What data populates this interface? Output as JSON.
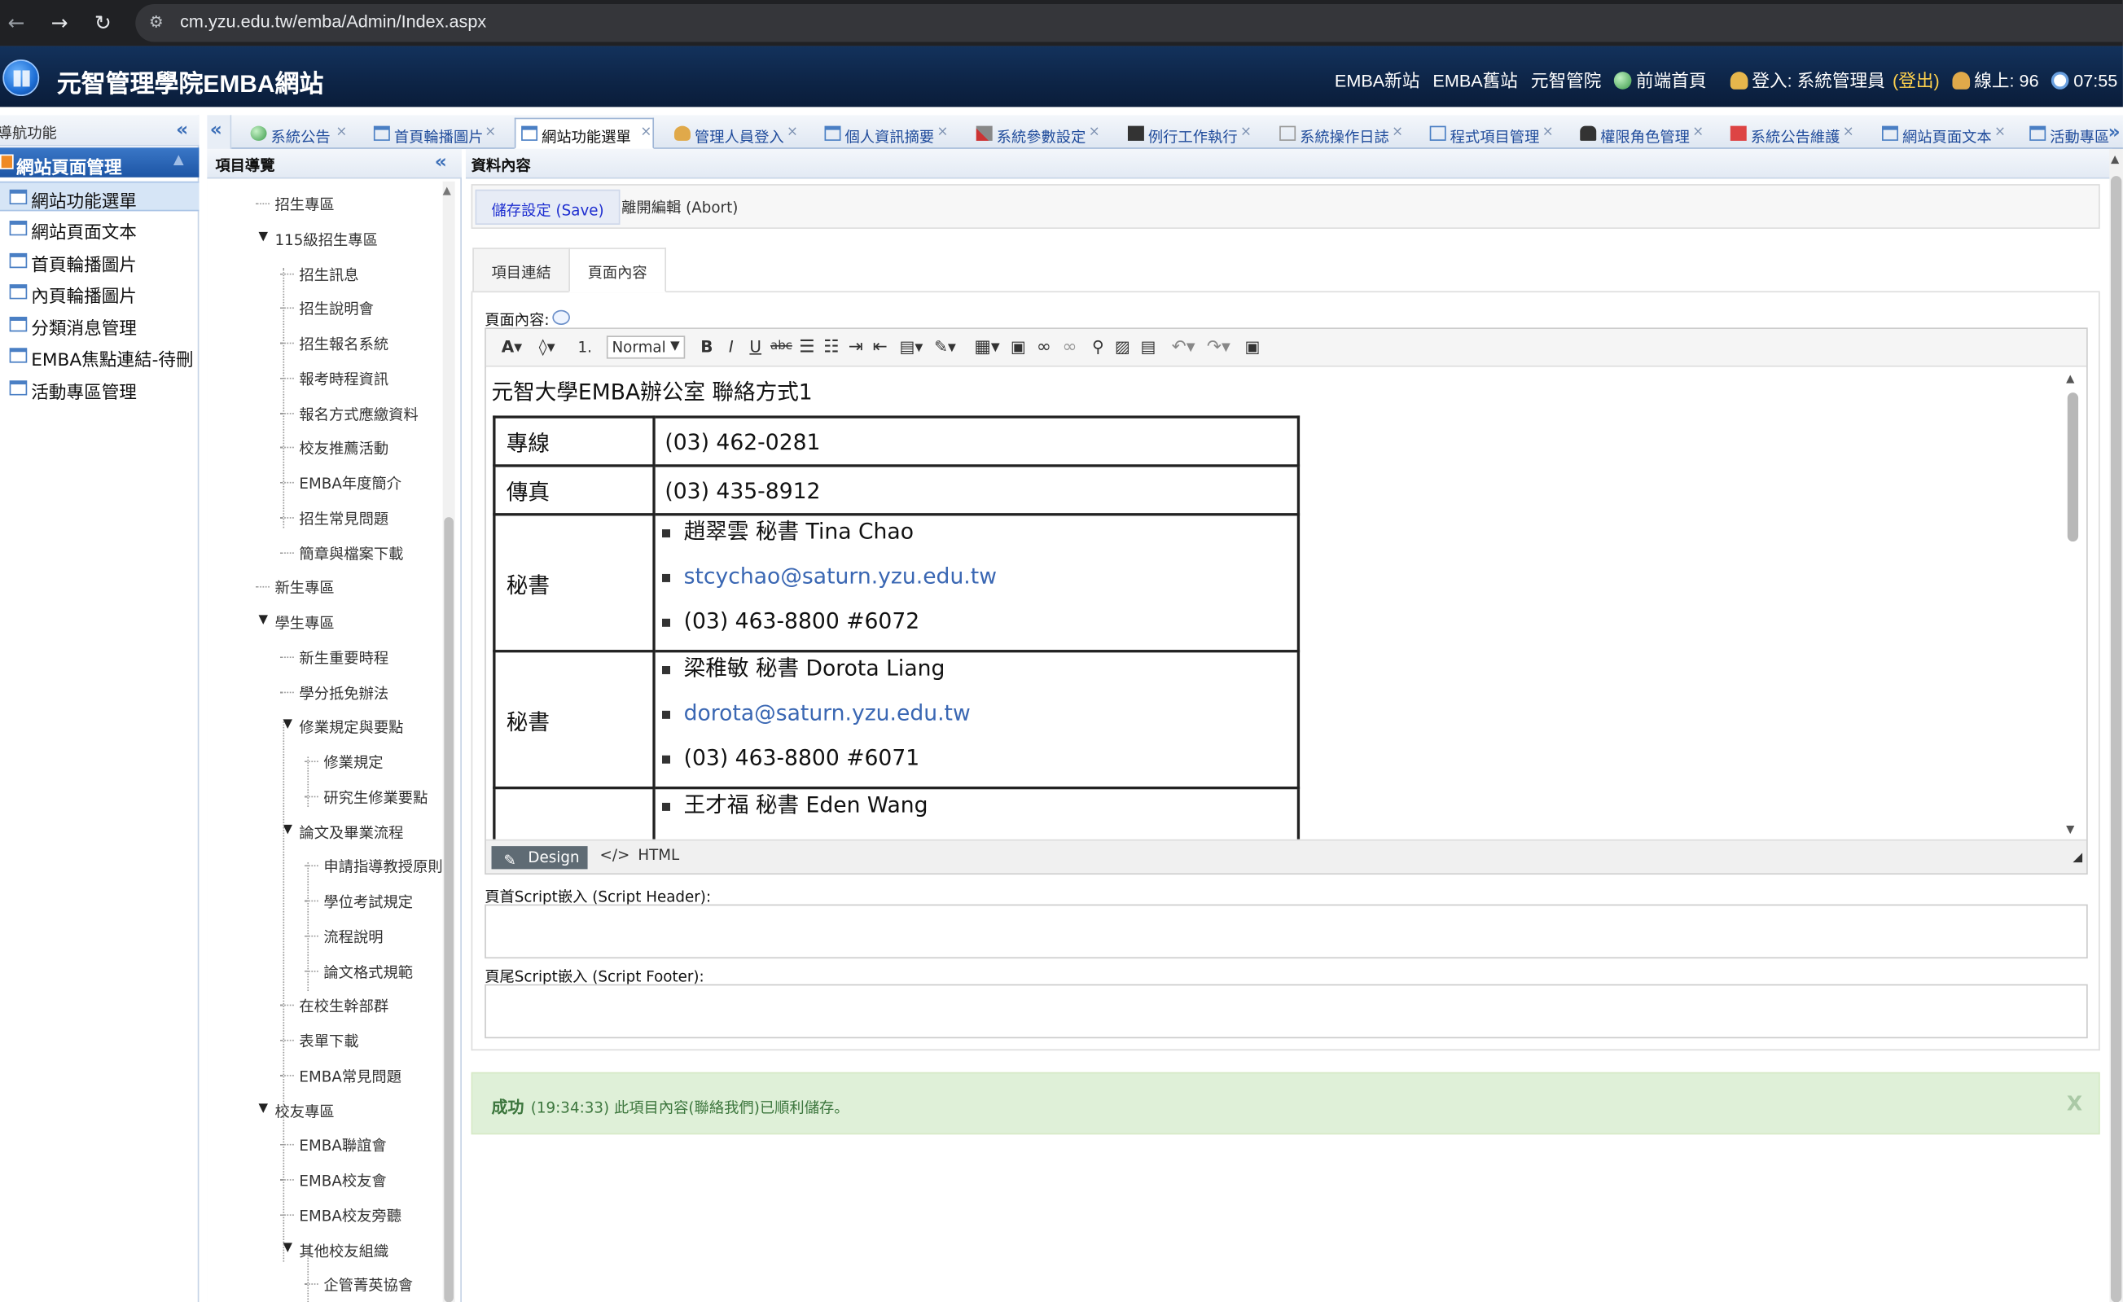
{
  "browser": {
    "url": "cm.yzu.edu.tw/emba/Admin/Index.aspx"
  },
  "header": {
    "title": "元智管理學院EMBA網站",
    "links": [
      "EMBA新站",
      "EMBA舊站",
      "元智管院"
    ],
    "frontend": "前端首頁",
    "login_label": "登入: 系統管理員",
    "logout": "(登出)",
    "online": "線上: 96",
    "time": "07:55"
  },
  "left_sidebar": {
    "title": "導航功能",
    "section": "網站頁面管理",
    "items": [
      {
        "label": "網站功能選單",
        "selected": true
      },
      {
        "label": "網站頁面文本"
      },
      {
        "label": "首頁輪播圖片"
      },
      {
        "label": "內頁輪播圖片"
      },
      {
        "label": "分類消息管理"
      },
      {
        "label": "EMBA焦點連結-待刪"
      },
      {
        "label": "活動專區管理"
      }
    ]
  },
  "tabs": [
    {
      "label": "系統公告"
    },
    {
      "label": "首頁輪播圖片"
    },
    {
      "label": "網站功能選單",
      "active": true
    },
    {
      "label": "管理人員登入"
    },
    {
      "label": "個人資訊摘要"
    },
    {
      "label": "系統參數設定"
    },
    {
      "label": "例行工作執行"
    },
    {
      "label": "系統操作日誌"
    },
    {
      "label": "程式項目管理"
    },
    {
      "label": "權限角色管理"
    },
    {
      "label": "系統公告維護"
    },
    {
      "label": "網站頁面文本"
    },
    {
      "label": "活動專區"
    }
  ],
  "tree": {
    "title": "項目導覽",
    "nodes": [
      {
        "label": "招生專區",
        "level": 1
      },
      {
        "label": "115級招生專區",
        "level": 1,
        "expanded": true
      },
      {
        "label": "招生訊息",
        "level": 2
      },
      {
        "label": "招生說明會",
        "level": 2
      },
      {
        "label": "招生報名系統",
        "level": 2
      },
      {
        "label": "報考時程資訊",
        "level": 2
      },
      {
        "label": "報名方式應繳資料",
        "level": 2
      },
      {
        "label": "校友推薦活動",
        "level": 2
      },
      {
        "label": "EMBA年度簡介",
        "level": 2
      },
      {
        "label": "招生常見問題",
        "level": 2
      },
      {
        "label": "簡章與檔案下載",
        "level": 2
      },
      {
        "label": "新生專區",
        "level": 1
      },
      {
        "label": "學生專區",
        "level": 1,
        "expanded": true
      },
      {
        "label": "新生重要時程",
        "level": 2
      },
      {
        "label": "學分抵免辦法",
        "level": 2
      },
      {
        "label": "修業規定與要點",
        "level": 2,
        "expanded": true
      },
      {
        "label": "修業規定",
        "level": 3
      },
      {
        "label": "研究生修業要點",
        "level": 3
      },
      {
        "label": "論文及畢業流程",
        "level": 2,
        "expanded": true
      },
      {
        "label": "申請指導教授原則",
        "level": 3
      },
      {
        "label": "學位考試規定",
        "level": 3
      },
      {
        "label": "流程說明",
        "level": 3
      },
      {
        "label": "論文格式規範",
        "level": 3
      },
      {
        "label": "在校生幹部群",
        "level": 2
      },
      {
        "label": "表單下載",
        "level": 2
      },
      {
        "label": "EMBA常見問題",
        "level": 2
      },
      {
        "label": "校友專區",
        "level": 1,
        "expanded": true
      },
      {
        "label": "EMBA聯誼會",
        "level": 2
      },
      {
        "label": "EMBA校友會",
        "level": 2
      },
      {
        "label": "EMBA校友旁聽",
        "level": 2
      },
      {
        "label": "其他校友組織",
        "level": 2,
        "expanded": true
      },
      {
        "label": "企管菁英協會",
        "level": 3
      }
    ]
  },
  "content": {
    "title": "資料內容",
    "save_label": "儲存設定 (Save)",
    "abort_label": "離開編輯 (Abort)",
    "subtabs": [
      "項目連結",
      "頁面內容"
    ],
    "active_subtab": "頁面內容",
    "page_content_label": "頁面內容:",
    "editor": {
      "format_value": "Normal",
      "size_value": "1.",
      "doc_title": "元智大學EMBA辦公室 聯絡方式1",
      "rows": [
        {
          "key": "專線",
          "value": "(03) 462-0281"
        },
        {
          "key": "傳真",
          "value": "(03) 435-8912"
        },
        {
          "key": "秘書",
          "items": [
            "趙翠雲 秘書 Tina Chao",
            "stcychao@saturn.yzu.edu.tw",
            "(03) 463-8800 #6072"
          ]
        },
        {
          "key": "秘書",
          "items": [
            "梁稚敏 秘書 Dorota Liang",
            "dorota@saturn.yzu.edu.tw",
            "(03) 463-8800 #6071"
          ]
        },
        {
          "key": "",
          "items": [
            "王才福 秘書 Eden Wang"
          ]
        }
      ],
      "design_label": "Design",
      "html_label": "HTML"
    },
    "script_header_label": "頁首Script嵌入 (Script Header):",
    "script_footer_label": "頁尾Script嵌入 (Script Footer):",
    "alert": {
      "strong": "成功",
      "message": "(19:34:33) 此項目內容(聯絡我們)已順利儲存。",
      "close": "X"
    }
  }
}
